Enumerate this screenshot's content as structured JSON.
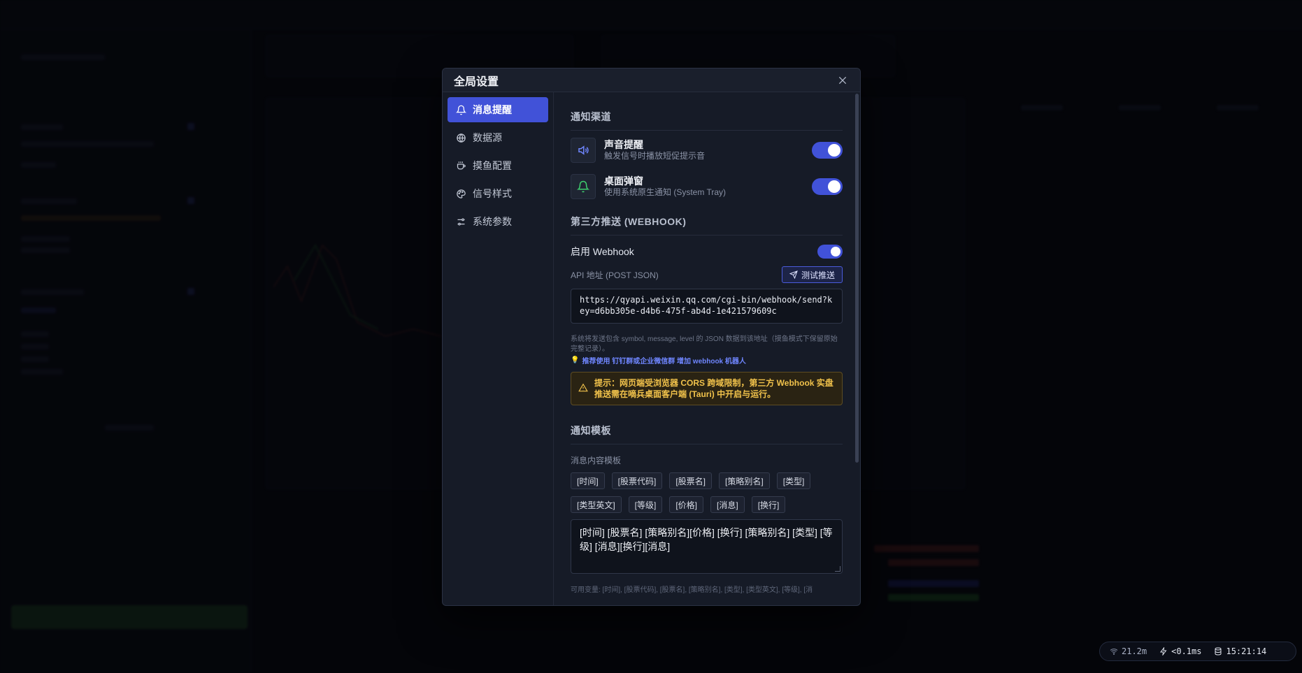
{
  "modal": {
    "title": "全局设置",
    "nav": [
      {
        "label": "消息提醒",
        "icon": "bell-icon",
        "active": true
      },
      {
        "label": "数据源",
        "icon": "globe-icon",
        "active": false
      },
      {
        "label": "摸鱼配置",
        "icon": "coffee-icon",
        "active": false
      },
      {
        "label": "信号样式",
        "icon": "palette-icon",
        "active": false
      },
      {
        "label": "系统参数",
        "icon": "sliders-icon",
        "active": false
      }
    ],
    "channels": {
      "title": "通知渠道",
      "sound": {
        "title": "声音提醒",
        "desc": "触发信号时播放短促提示音",
        "enabled": true
      },
      "desktop": {
        "title": "桌面弹窗",
        "desc": "使用系统原生通知 (System Tray)",
        "enabled": true
      }
    },
    "webhook": {
      "title": "第三方推送 (WEBHOOK)",
      "enable_label": "启用 Webhook",
      "enabled": true,
      "api_label": "API 地址 (POST JSON)",
      "test_button": "测试推送",
      "url": "https://qyapi.weixin.qq.com/cgi-bin/webhook/send?key=d6bb305e-d4b6-475f-ab4d-1e421579609c",
      "hint": "系统将发送包含 symbol, message, level 的 JSON 数据到该地址（摸鱼模式下保留原始完整记录）。",
      "recommend": "推荐使用 钉钉群或企业微信群 增加 webhook 机器人",
      "warning": "提示：网页端受浏览器 CORS 跨域限制，第三方 Webhook 实盘推送需在嘀兵桌面客户端 (Tauri) 中开启与运行。"
    },
    "template": {
      "title": "通知模板",
      "content_label": "消息内容模板",
      "tags_row1": [
        "[时间]",
        "[股票代码]",
        "[股票名]",
        "[策略别名]",
        "[类型]"
      ],
      "tags_row2": [
        "[类型英文]",
        "[等级]",
        "[价格]",
        "[消息]",
        "[换行]"
      ],
      "value": "[时间]  [股票名]  [策略别名][价格]  [换行]  [策略别名]      [类型]      [等级]  [消息][换行][消息]",
      "vars": "可用变量: [时间], [股票代码], [股票名], [策略别名], [类型], [类型英文], [等级], [消"
    }
  },
  "status": {
    "network": "21.2m",
    "latency": "<0.1ms",
    "clock": "15:21:14"
  },
  "colors": {
    "accent": "#4152d8",
    "warning": "#f1c24b",
    "bell_green": "#3ecf6e",
    "speaker_blue": "#6f86ff"
  }
}
